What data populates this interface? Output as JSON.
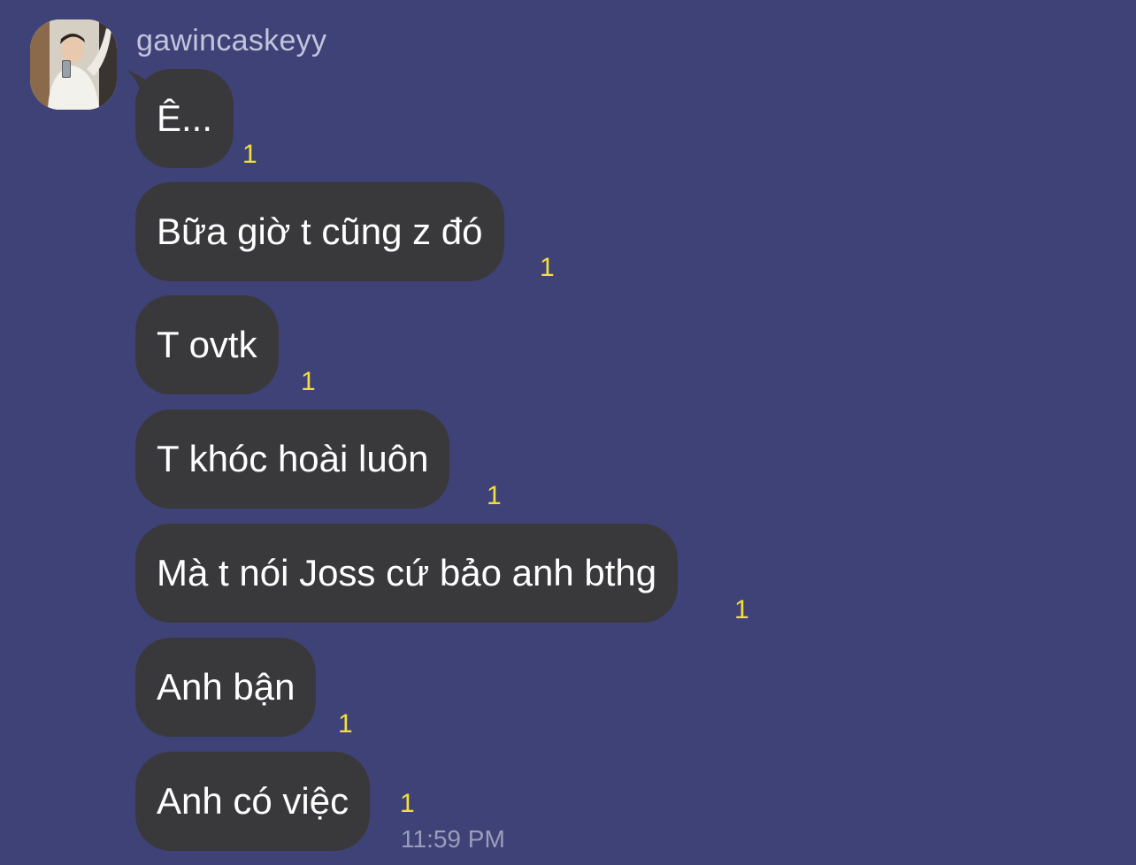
{
  "sender": {
    "name": "gawincaskeyy"
  },
  "messages": [
    {
      "text": "Ê...",
      "read_count": "1"
    },
    {
      "text": "Bữa giờ t cũng z đó",
      "read_count": "1"
    },
    {
      "text": "T ovtk",
      "read_count": "1"
    },
    {
      "text": "T khóc hoài luôn",
      "read_count": "1"
    },
    {
      "text": "Mà t nói Joss cứ bảo anh bthg",
      "read_count": "1"
    },
    {
      "text": "Anh bận",
      "read_count": "1"
    },
    {
      "text": "Anh có việc",
      "read_count": "1"
    }
  ],
  "last_message_time": "11:59 PM",
  "colors": {
    "background": "#3f4276",
    "bubble": "#39393c",
    "bubble_text": "#ffffff",
    "read_count": "#f2e03a",
    "sender_name": "#c3c4de",
    "timestamp": "#9b9dbb"
  }
}
